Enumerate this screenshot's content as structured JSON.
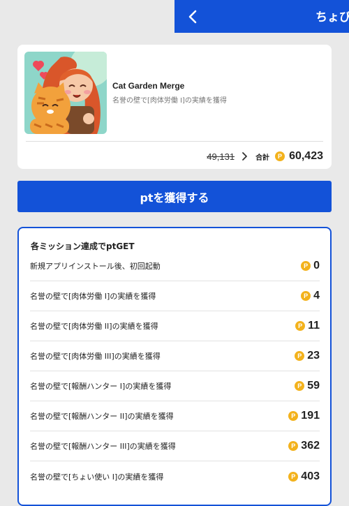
{
  "header": {
    "title": "ちょび"
  },
  "app": {
    "name": "Cat Garden Merge",
    "description": "名誉の壁で[肉体労働 I]の実績を獲得",
    "old_points": "49,131",
    "total_label": "合計",
    "total_points": "60,423"
  },
  "coin_symbol": "P",
  "get_button_label": "ptを獲得する",
  "missions": {
    "heading": "各ミッション達成でptGET",
    "items": [
      {
        "label": "新規アプリインストール後、初回起動",
        "points": "0"
      },
      {
        "label": "名誉の壁で[肉体労働 I]の実績を獲得",
        "points": "4"
      },
      {
        "label": "名誉の壁で[肉体労働 II]の実績を獲得",
        "points": "11"
      },
      {
        "label": "名誉の壁で[肉体労働 III]の実績を獲得",
        "points": "23"
      },
      {
        "label": "名誉の壁で[報酬ハンター I]の実績を獲得",
        "points": "59"
      },
      {
        "label": "名誉の壁で[報酬ハンター II]の実績を獲得",
        "points": "191"
      },
      {
        "label": "名誉の壁で[報酬ハンター III]の実績を獲得",
        "points": "362"
      },
      {
        "label": "名誉の壁で[ちょい使い I]の実績を獲得",
        "points": "403"
      }
    ]
  },
  "colors": {
    "brand": "#1352d8",
    "coin": "#f3b21c"
  }
}
